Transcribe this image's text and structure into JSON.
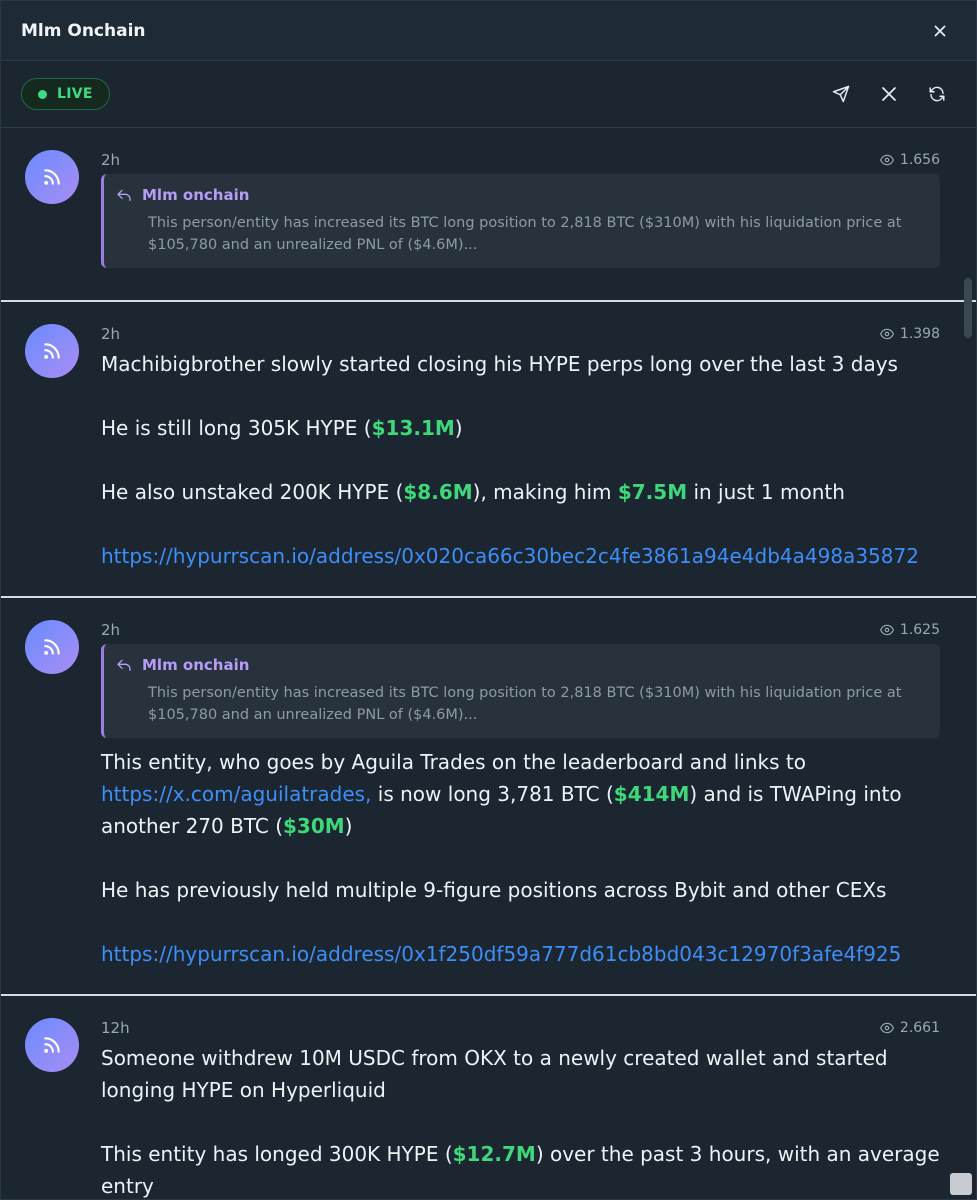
{
  "window": {
    "title": "Mlm Onchain"
  },
  "toolbar": {
    "live_label": "LIVE"
  },
  "posts": [
    {
      "time": "2h",
      "views": "1.656",
      "quote": {
        "author": "Mlm onchain",
        "text": "This person/entity has increased its BTC long position to 2,818 BTC ($310M) with his liquidation price at $105,780 and an unrealized PNL of ($4.6M)..."
      }
    },
    {
      "time": "2h",
      "views": "1.398",
      "p1": "Machibigbrother slowly started closing his HYPE perps long over the last 3 days",
      "p2_a": "He is still long 305K HYPE (",
      "p2_g": "$13.1M",
      "p2_b": ")",
      "p3_a": "He also unstaked 200K HYPE (",
      "p3_g1": "$8.6M",
      "p3_b": "), making him ",
      "p3_g2": "$7.5M",
      "p3_c": " in just 1 month",
      "link": "https://hypurrscan.io/address/0x020ca66c30bec2c4fe3861a94e4db4a498a35872"
    },
    {
      "time": "2h",
      "views": "1.625",
      "quote": {
        "author": "Mlm onchain",
        "text": "This person/entity has increased its BTC long position to 2,818 BTC ($310M) with his liquidation price at $105,780 and an unrealized PNL of ($4.6M)..."
      },
      "p1_a": "This entity, who goes by Aguila Trades on the leaderboard and links to ",
      "p1_link": "https://x.com/aguilatrades,",
      "p1_b": " is now long 3,781 BTC (",
      "p1_g1": "$414M",
      "p1_c": ") and is TWAPing into another 270 BTC (",
      "p1_g2": "$30M",
      "p1_d": ")",
      "p2": "He has previously held multiple 9-figure positions across Bybit and other CEXs",
      "link": "https://hypurrscan.io/address/0x1f250df59a777d61cb8bd043c12970f3afe4f925"
    },
    {
      "time": "12h",
      "views": "2.661",
      "p1": "Someone withdrew 10M USDC from OKX to a newly created wallet and started longing HYPE on Hyperliquid",
      "p2_a": "This entity has longed 300K HYPE (",
      "p2_g": "$12.7M",
      "p2_b": ") over the past 3 hours, with an average entry"
    }
  ],
  "icons": {
    "close": "close-icon",
    "send": "send-icon",
    "x": "x-logo-icon",
    "refresh": "refresh-icon",
    "avatar": "rss-icon",
    "views": "eye-icon",
    "reply": "reply-icon"
  },
  "colors": {
    "accent_green": "#3fd77a",
    "link": "#3e8ef7",
    "quote_border": "#9b7fe0"
  }
}
